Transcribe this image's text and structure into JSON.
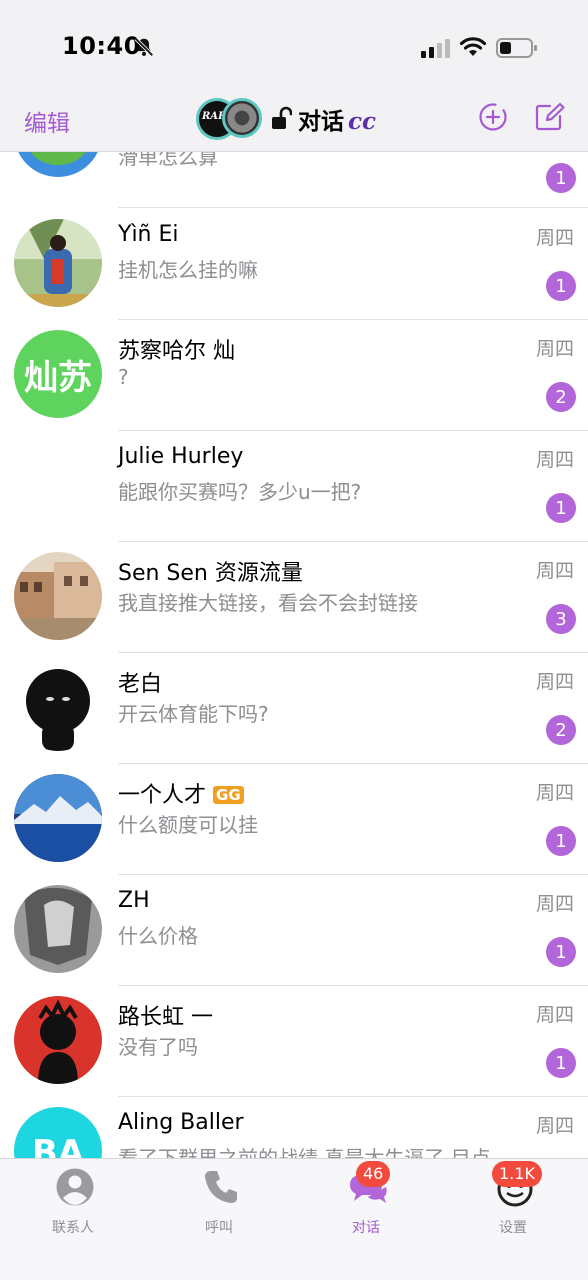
{
  "status_bar": {
    "time": "10:40"
  },
  "nav": {
    "edit_label": "编辑",
    "logo_text": "RARE",
    "title": "对话",
    "title_suffix": "cc",
    "accent_color": "#a55ad1"
  },
  "conversations": [
    {
      "name": "",
      "message": "滑单怎么算",
      "time": "",
      "unread": "1",
      "avatar_color": "#3e8ee0"
    },
    {
      "name": "Yìñ Ei",
      "message": "挂机怎么挂的嘛",
      "time": "周四",
      "unread": "1",
      "avatar_color": "#c9b24a"
    },
    {
      "name": "苏察哈尔 灿",
      "message": "?",
      "time": "周四",
      "unread": "2",
      "avatar_text": "灿苏",
      "avatar_color": "#5ed35e"
    },
    {
      "name": "Julie Hurley",
      "message": "能跟你买赛吗？多少u一把?",
      "time": "周四",
      "unread": "1",
      "avatar_color": "#ffffff"
    },
    {
      "name": "Sen Sen 资源流量",
      "message": "我直接推大链接，看会不会封链接",
      "time": "周四",
      "unread": "3",
      "avatar_color": "#b59a7c"
    },
    {
      "name": "老白",
      "message": "开云体育能下吗?",
      "time": "周四",
      "unread": "2",
      "avatar_color": "#111111"
    },
    {
      "name": "一个人才",
      "message": "什么额度可以挂",
      "time": "周四",
      "unread": "1",
      "avatar_color": "#2a5ea8",
      "name_badge": "GG"
    },
    {
      "name": "ZH",
      "message": "什么价格",
      "time": "周四",
      "unread": "1",
      "avatar_color": "#777777"
    },
    {
      "name": "路长虹 一",
      "message": "没有了吗",
      "time": "周四",
      "unread": "1",
      "avatar_color": "#d8342c"
    },
    {
      "name": "Aling Baller",
      "message": "看了下群里之前的战绩 真是太牛逼了 目点",
      "time": "周四",
      "unread": "",
      "avatar_text": "BA",
      "avatar_color": "#1ed6e0"
    }
  ],
  "tab_bar": {
    "tabs": [
      {
        "label": "联系人",
        "icon": "person-icon",
        "badge": ""
      },
      {
        "label": "呼叫",
        "icon": "phone-icon",
        "badge": ""
      },
      {
        "label": "对话",
        "icon": "chat-bubbles-icon",
        "badge": "46"
      },
      {
        "label": "设置",
        "icon": "settings-face-icon",
        "badge": "1.1K"
      }
    ]
  }
}
